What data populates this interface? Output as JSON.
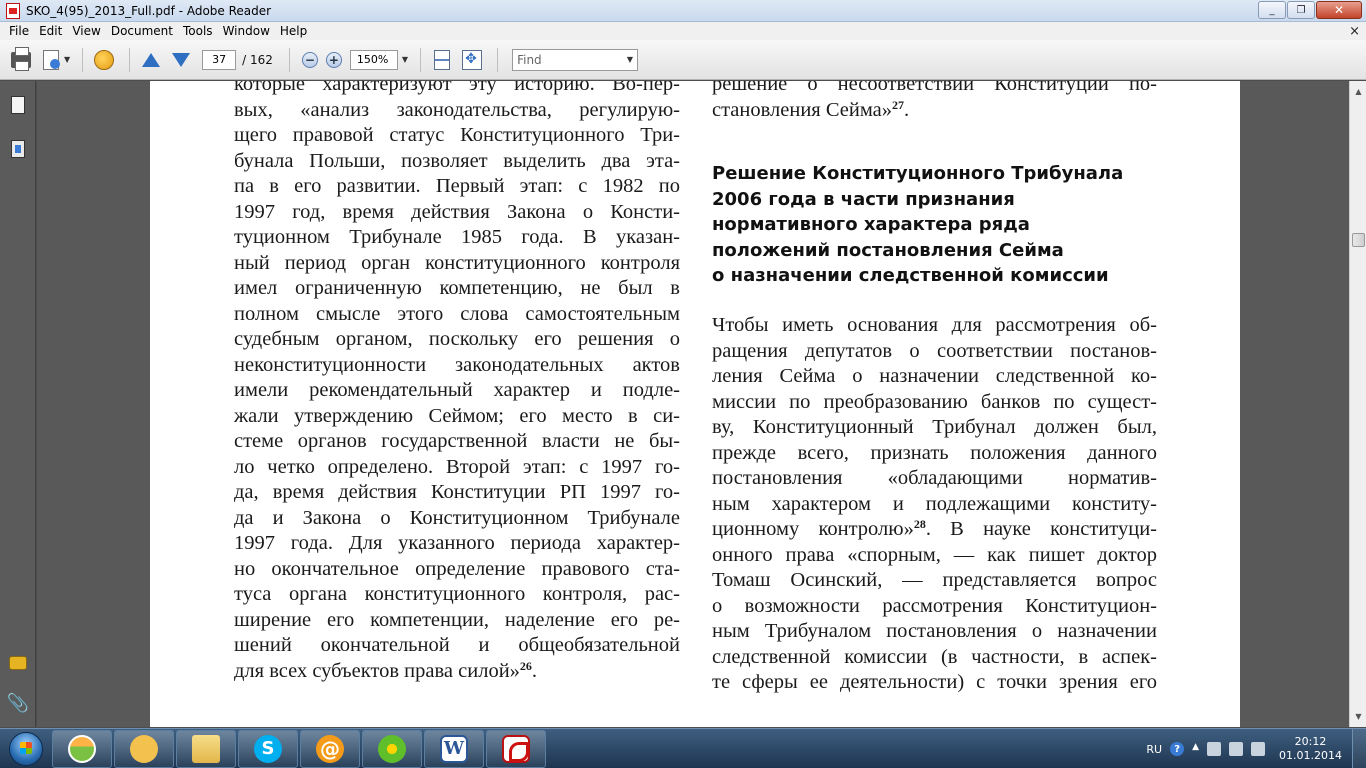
{
  "window": {
    "title": "SKO_4(95)_2013_Full.pdf - Adobe Reader",
    "minimize": "_",
    "maximize": "❐",
    "close": "✕"
  },
  "menu": {
    "items": [
      "File",
      "Edit",
      "View",
      "Document",
      "Tools",
      "Window",
      "Help"
    ],
    "close_doc": "×"
  },
  "toolbar": {
    "page_current": "37",
    "page_total": "/ 162",
    "zoom_value": "150%",
    "zoom_out": "−",
    "zoom_in": "+",
    "find_placeholder": "Find"
  },
  "document": {
    "left_column": [
      "которые характеризуют эту историю. Во-пер-",
      "вых, «анализ законодательства, регулирую-",
      "щего правовой статус Конституционного Три-",
      "бунала Польши, позволяет выделить два эта-",
      "па в его развитии. Первый этап: с 1982 по",
      "1997 год, время действия Закона о Консти-",
      "туционном Трибунале 1985 года. В указан-",
      "ный период орган конституционного контроля",
      "имел ограниченную компетенцию, не был в",
      "полном смысле этого слова самостоятельным",
      "судебным органом, поскольку его решения о",
      "неконституционности законодательных актов",
      "имели рекомендательный характер и подле-",
      "жали утверждению Сеймом; его место в си-",
      "стеме органов государственной власти не бы-",
      "ло четко определено. Второй этап: с 1997 го-",
      "да, время действия Конституции РП 1997 го-",
      "да и Закона о Конституционном Трибунале",
      "1997 года. Для указанного периода характер-",
      "но окончательное определение правового ста-",
      "туса органа конституционного контроля, рас-",
      "ширение его компетенции, наделение его ре-",
      "шений окончательной и общеобязательной",
      "для всех субъектов права силой»"
    ],
    "left_footnote": "26",
    "left_end": ".",
    "right_top": [
      "решение о несоответствии Конституции по-",
      "становления Сейма»"
    ],
    "right_top_footnote": "27",
    "right_top_end": ".",
    "heading": [
      "Решение Конституционного Трибунала",
      "2006 года в части признания",
      "нормативного характера ряда",
      "положений постановления Сейма",
      "о назначении следственной комиссии"
    ],
    "right_body_a": [
      "Чтобы иметь основания для рассмотрения об-",
      "ращения депутатов о соответствии постанов-",
      "ления Сейма о назначении следственной ко-",
      "миссии по преобразованию банков по сущест-",
      "ву, Конституционный Трибунал должен был,",
      "прежде всего, признать положения данного",
      "постановления «обладающими норматив-",
      "ным характером и подлежащими конститу-"
    ],
    "right_body_b_pre": "ционному контролю»",
    "right_body_b_footnote": "28",
    "right_body_b_post": ". В науке конституци-",
    "right_body_c": [
      "онного права «спорным, — как пишет доктор",
      "Томаш Осинский, — представляется вопрос",
      "о возможности рассмотрения Конституцион-",
      "ным Трибуналом постановления о назначении",
      "следственной комиссии (в частности, в аспек-",
      "те сферы ее деятельности) с точки зрения его"
    ]
  },
  "taskbar": {
    "skype_glyph": "S",
    "mail_glyph": "@",
    "word_glyph": "W",
    "tray_lang": "RU",
    "help_glyph": "?",
    "time": "20:12",
    "date": "01.01.2014"
  },
  "colors": {
    "doc_background": "#595959",
    "page": "#ffffff",
    "taskbar": "#1e3550"
  }
}
